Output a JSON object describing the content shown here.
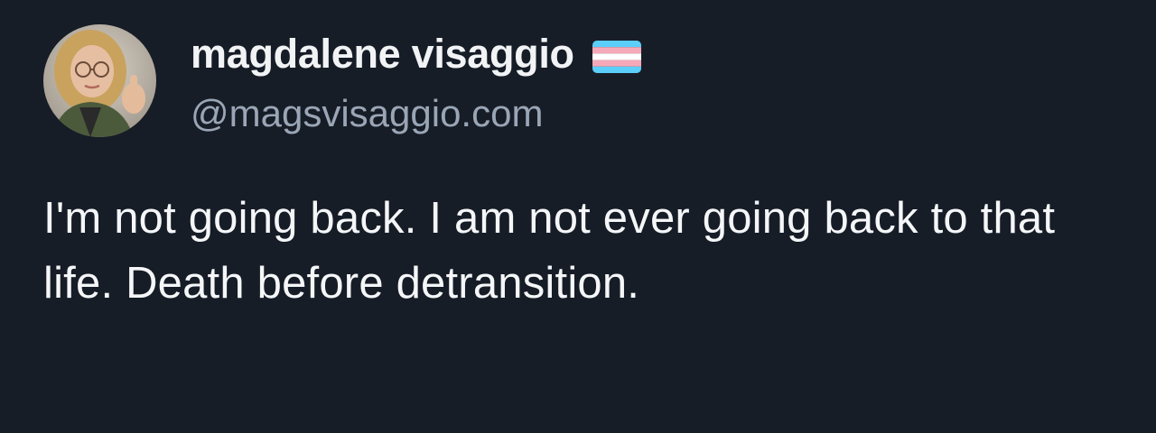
{
  "author": {
    "display_name": "magdalene visaggio",
    "handle": "@magsvisaggio.com",
    "avatar": "profile-photo",
    "badge_icon": "transgender-flag-icon"
  },
  "post": {
    "text": "I'm not going back. I am not ever going back to that life. Death before detransition."
  },
  "colors": {
    "background": "#171d27",
    "display_name": "#f1f3f5",
    "handle": "#9aa6b6",
    "text": "#f4f6f8",
    "flag_blue": "#5bcefa",
    "flag_pink": "#f5a9b8",
    "flag_white": "#ffffff"
  }
}
